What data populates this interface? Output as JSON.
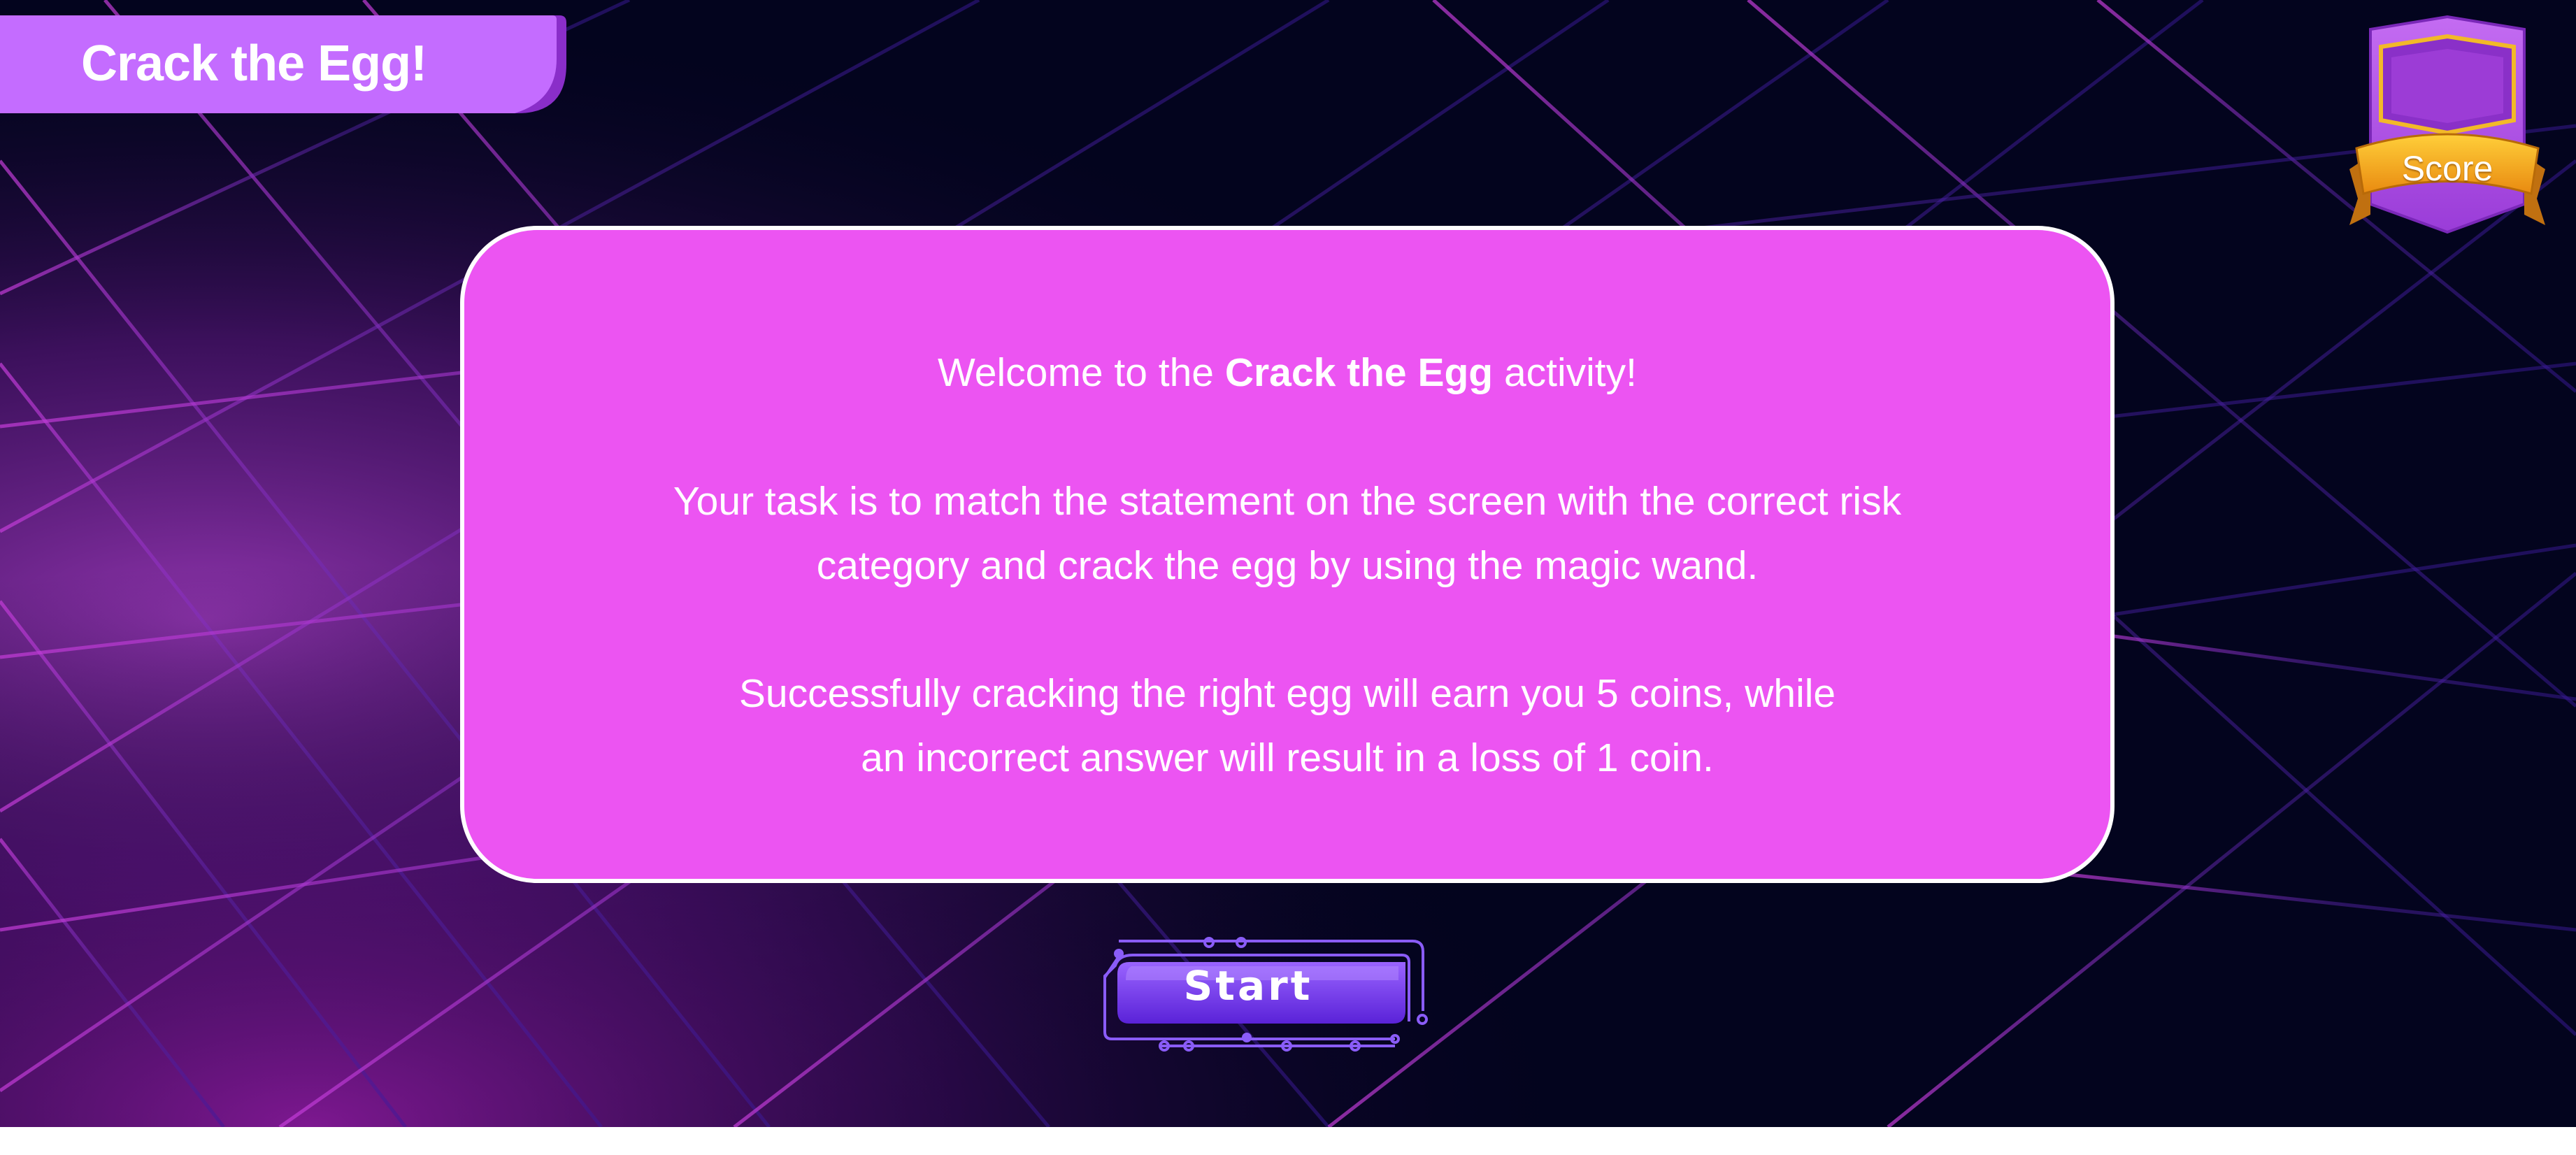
{
  "game": {
    "title": "Crack the Egg!",
    "score_label": "Score"
  },
  "instructions": {
    "intro_before": "Welcome to the ",
    "intro_bold": "Crack the Egg",
    "intro_after": " activity!",
    "task_line1": "Your task is to match the statement on the screen with the correct risk",
    "task_line2": "category and crack the egg by using the magic wand.",
    "reward_line1": "Successfully cracking the right egg will earn you 5 coins, while",
    "reward_line2": "an incorrect answer will result in a loss of 1 coin."
  },
  "actions": {
    "start_label": "Start"
  },
  "colors": {
    "background": "#03041e",
    "panel": "#ec54f2",
    "title_tab": "#c46cff",
    "accent_purple": "#7a3cf0",
    "ribbon_gold": "#f7a21b"
  },
  "icons": {
    "score_badge": "shield-badge-icon",
    "start_frame": "circuit-frame-icon"
  }
}
